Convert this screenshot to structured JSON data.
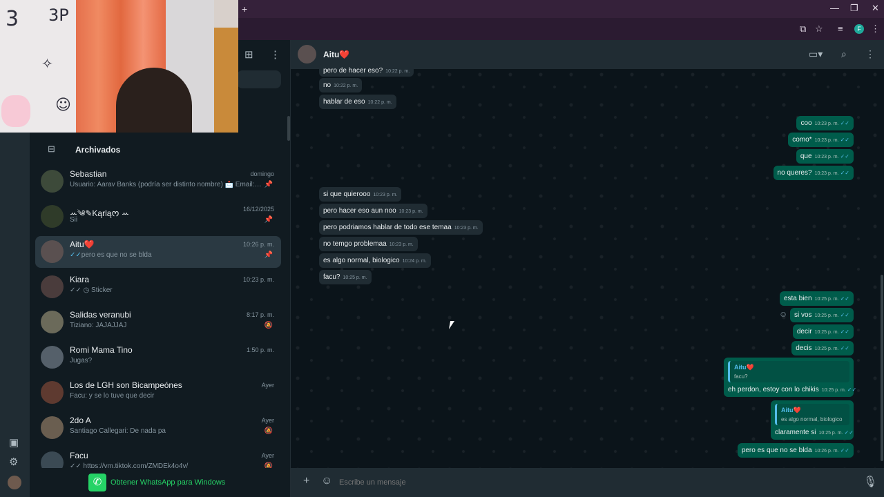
{
  "browser": {
    "new_tab_icon": "+",
    "minimize": "—",
    "restore": "❐",
    "close": "✕",
    "profile_initial": "F"
  },
  "webcam": {
    "doodle_text_1": "3",
    "doodle_text_2": "3P",
    "doodle_text_3": "✧",
    "doodle_text_4": "☺"
  },
  "sidebar": {
    "archived_label": "Archivados",
    "chats": [
      {
        "name": "Sebastian",
        "time": "domingo",
        "preview": "Usuario: Aarav Banks (podría ser distinto nombre) 📩 Email: exen...",
        "meta": "📌"
      },
      {
        "name": "ꕀ༄✎Kąrląᰔ ꕀ",
        "time": "16/12/2025",
        "preview": "Sii",
        "meta": "📌"
      },
      {
        "name": "Aitu❤️",
        "time": "10:26 p. m.",
        "preview": "pero es que no se blda",
        "meta": "📌",
        "ticks": "✓✓"
      },
      {
        "name": "Kiara",
        "time": "10:23 p. m.",
        "preview": "✓✓ ◷ Sticker",
        "meta": ""
      },
      {
        "name": "Salidas veranubi",
        "time": "8:17 p. m.",
        "preview": "Tiziano: JAJAJJAJ",
        "meta": "🔕"
      },
      {
        "name": "Romi Mama Tino",
        "time": "1:50 p. m.",
        "preview": "Jugas?",
        "meta": ""
      },
      {
        "name": "Los de LGH son Bicampeónes",
        "time": "Ayer",
        "preview": "Facu: y se lo tuve que decir",
        "meta": ""
      },
      {
        "name": "2do A",
        "time": "Ayer",
        "preview": "Santiago Callegari: De nada pa",
        "meta": "🔕"
      },
      {
        "name": "Facu",
        "time": "Ayer",
        "preview": "✓✓ https://vm.tiktok.com/ZMDEk4o4v/",
        "meta": "🔕"
      }
    ],
    "get_app_label": "Obtener WhatsApp para Windows"
  },
  "conversation": {
    "contact_name": "Aitu❤️",
    "messages": [
      {
        "dir": "in",
        "text": "pero de hacer eso?",
        "time": "10:22 p. m."
      },
      {
        "dir": "in",
        "text": "no",
        "time": "10:22 p. m."
      },
      {
        "dir": "in",
        "text": "hablar de eso",
        "time": "10:22 p. m."
      },
      {
        "dir": "out",
        "text": "coo",
        "time": "10:23 p. m."
      },
      {
        "dir": "out",
        "text": "como*",
        "time": "10:23 p. m."
      },
      {
        "dir": "out",
        "text": "que",
        "time": "10:23 p. m."
      },
      {
        "dir": "out",
        "text": "no queres?",
        "time": "10:23 p. m."
      },
      {
        "dir": "in",
        "text": "si que quierooo",
        "time": "10:23 p. m."
      },
      {
        "dir": "in",
        "text": "pero hacer eso aun noo",
        "time": "10:23 p. m."
      },
      {
        "dir": "in",
        "text": "pero podriamos hablar de todo ese temaa",
        "time": "10:23 p. m."
      },
      {
        "dir": "in",
        "text": "no temgo problemaa",
        "time": "10:23 p. m."
      },
      {
        "dir": "in",
        "text": "es algo normal, biologico",
        "time": "10:24 p. m."
      },
      {
        "dir": "in",
        "text": "facu?",
        "time": "10:25 p. m."
      },
      {
        "dir": "out",
        "text": "esta bien",
        "time": "10:25 p. m."
      },
      {
        "dir": "out",
        "text": "si vos",
        "time": "10:25 p. m."
      },
      {
        "dir": "out",
        "text": "decir",
        "time": "10:25 p. m."
      },
      {
        "dir": "out",
        "text": "decis",
        "time": "10:25 p. m."
      },
      {
        "dir": "out",
        "text": "eh perdon, estoy con lo chikis",
        "time": "10:25 p. m.",
        "quote_name": "Aitu❤️",
        "quote_text": "facu?"
      },
      {
        "dir": "out",
        "text": "claramente si",
        "time": "10:25 p. m.",
        "quote_name": "Aitu❤️",
        "quote_text": "es algo normal, biologico"
      },
      {
        "dir": "out",
        "text": "pero es que no se blda",
        "time": "10:26 p. m."
      }
    ],
    "composer_placeholder": "Escribe un mensaje"
  },
  "colors": {
    "accent_green": "#25d366",
    "outgoing_bubble": "#005c4b",
    "incoming_bubble": "#202c33",
    "read_tick": "#53bdeb"
  },
  "icons": [
    "new-chat-icon",
    "menu-icon",
    "archive-icon",
    "pin-icon",
    "mute-icon",
    "video-call-icon",
    "search-icon",
    "attach-icon",
    "sticker-icon",
    "mic-icon",
    "gallery-icon",
    "settings-icon"
  ]
}
